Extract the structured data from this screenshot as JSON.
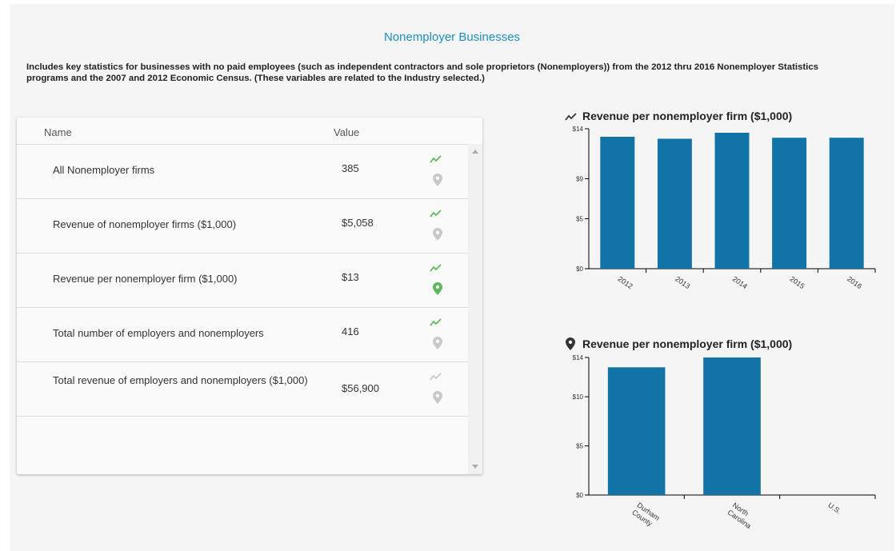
{
  "page": {
    "title": "Nonemployer Businesses",
    "description": "Includes key statistics for businesses with no paid employees (such as independent contractors and sole proprietors (Nonemployers)) from the 2012 thru 2016 Nonemployer Statistics programs and the 2007 and 2012 Economic Census. (These variables are related to the Industry selected.)"
  },
  "table": {
    "headers": {
      "name": "Name",
      "value": "Value"
    },
    "rows": [
      {
        "name": "All Nonemployer firms",
        "value": "385",
        "trend_active": true,
        "pin_active": false
      },
      {
        "name": "Revenue of nonemployer firms ($1,000)",
        "value": "$5,058",
        "trend_active": true,
        "pin_active": false
      },
      {
        "name": "Revenue per nonemployer firm ($1,000)",
        "value": "$13",
        "trend_active": true,
        "pin_active": true
      },
      {
        "name": "Total number of employers and nonemployers",
        "value": "416",
        "trend_active": true,
        "pin_active": false
      },
      {
        "name": "Total revenue of employers and nonemployers ($1,000)",
        "value": "$56,900",
        "trend_active": false,
        "pin_active": false
      }
    ]
  },
  "colors": {
    "bar": "#1273a6",
    "trend_active": "#5cb85c",
    "pin_active": "#5cb85c",
    "icon_inactive": "#c8c8c8",
    "title": "#1a8fc9"
  },
  "chart_data": [
    {
      "type": "bar",
      "icon": "trend-line-icon",
      "title": "Revenue per nonemployer firm ($1,000)",
      "categories": [
        "2012",
        "2013",
        "2014",
        "2015",
        "2016"
      ],
      "values": [
        13.2,
        13.0,
        13.6,
        13.1,
        13.1
      ],
      "ylim": [
        0,
        14
      ],
      "ytick_values": [
        0,
        5,
        9,
        14
      ],
      "ytick_labels": [
        "$0",
        "$5",
        "$9",
        "$14"
      ],
      "xlabel": "",
      "ylabel": "",
      "grid": false
    },
    {
      "type": "bar",
      "icon": "map-pin-icon",
      "title": "Revenue per nonemployer firm ($1,000)",
      "categories": [
        "Durham County",
        "North Carolina",
        "U.S."
      ],
      "values": [
        13.0,
        14.0,
        0
      ],
      "ylim": [
        0,
        14
      ],
      "ytick_values": [
        0,
        5,
        10,
        14
      ],
      "ytick_labels": [
        "$0",
        "$5",
        "$10",
        "$14"
      ],
      "xlabel": "",
      "ylabel": "",
      "grid": false
    }
  ]
}
